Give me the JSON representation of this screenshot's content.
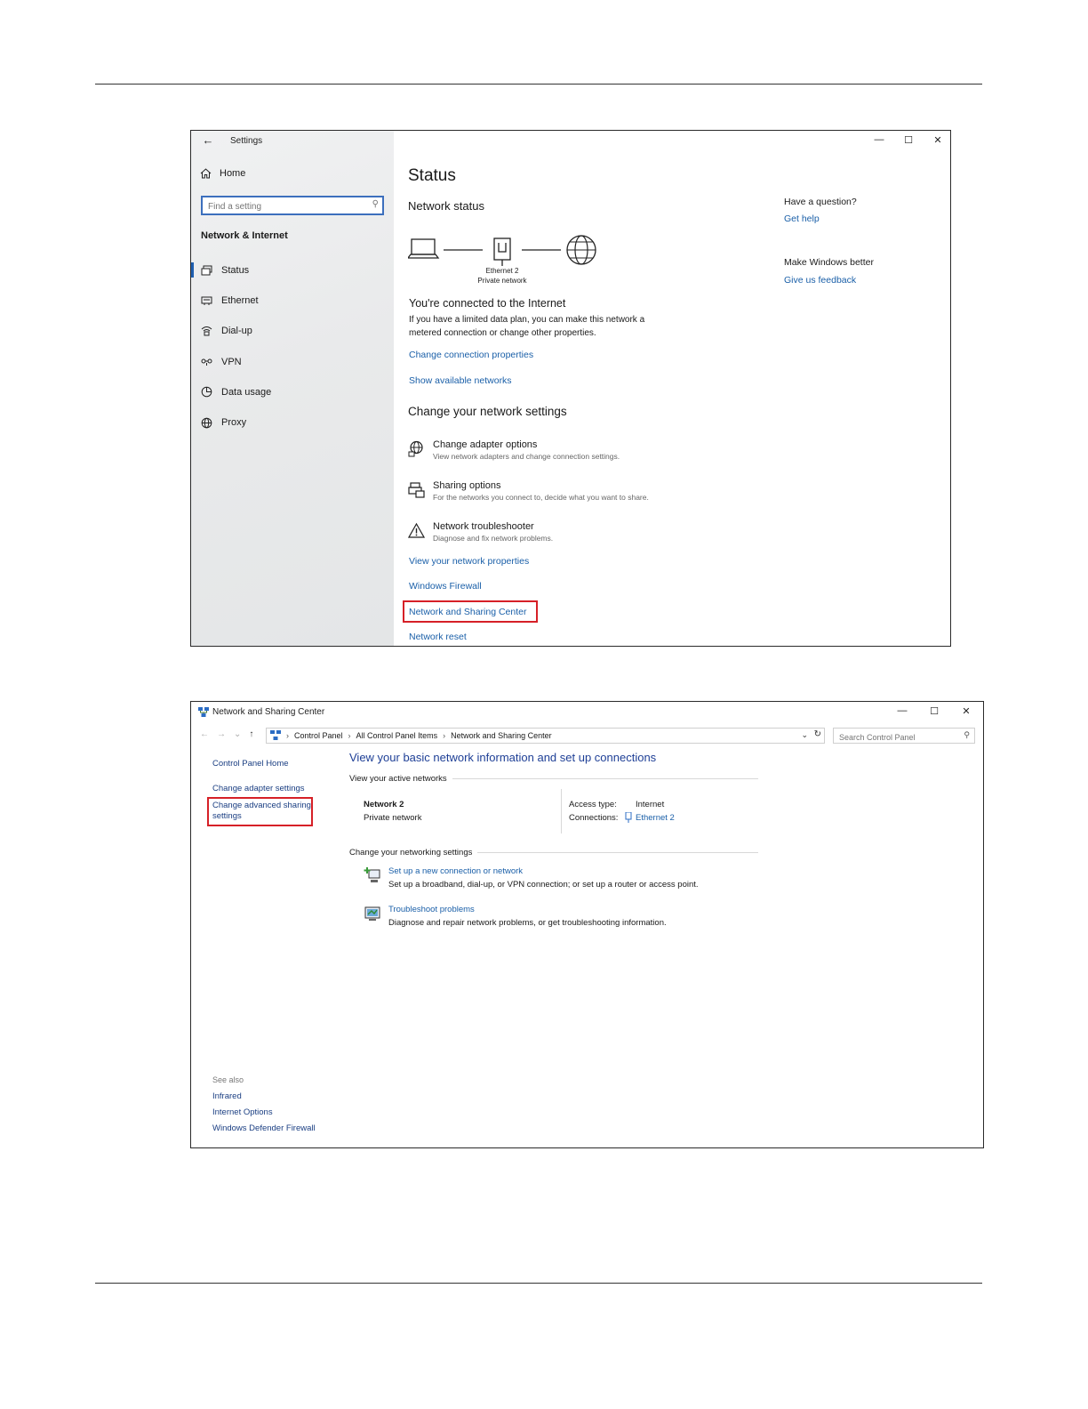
{
  "settings": {
    "window_title": "Settings",
    "home": "Home",
    "search_placeholder": "Find a setting",
    "section": "Network & Internet",
    "nav": [
      {
        "label": "Status",
        "icon": "status-icon"
      },
      {
        "label": "Ethernet",
        "icon": "ethernet-icon"
      },
      {
        "label": "Dial-up",
        "icon": "dialup-icon"
      },
      {
        "label": "VPN",
        "icon": "vpn-icon"
      },
      {
        "label": "Data usage",
        "icon": "data-usage-icon"
      },
      {
        "label": "Proxy",
        "icon": "proxy-icon"
      }
    ],
    "selected_nav": "Status",
    "controls": {
      "minimize": "—",
      "maximize": "☐",
      "close": "✕"
    },
    "page_title": "Status",
    "network_status": "Network status",
    "adapter_name": "Ethernet 2",
    "adapter_network": "Private network",
    "connected_title": "You're connected to the Internet",
    "connected_desc": "If you have a limited data plan, you can make this network a metered connection or change other properties.",
    "link_change_props": "Change connection properties",
    "link_show_networks": "Show available networks",
    "change_title": "Change your network settings",
    "options": [
      {
        "title": "Change adapter options",
        "desc": "View network adapters and change connection settings.",
        "icon": "adapter-icon"
      },
      {
        "title": "Sharing options",
        "desc": "For the networks you connect to, decide what you want to share.",
        "icon": "sharing-icon"
      },
      {
        "title": "Network troubleshooter",
        "desc": "Diagnose and fix network problems.",
        "icon": "warning-icon"
      }
    ],
    "link_view_props": "View your network properties",
    "link_firewall": "Windows Firewall",
    "link_nsc": "Network and Sharing Center",
    "link_reset": "Network reset",
    "aside": {
      "question": "Have a question?",
      "get_help": "Get help",
      "better": "Make Windows better",
      "feedback": "Give us feedback"
    },
    "highlight_color": "#d62027",
    "link_color": "#1a5fa8"
  },
  "nsc": {
    "window_title": "Network and Sharing Center",
    "controls": {
      "minimize": "—",
      "maximize": "☐",
      "close": "✕"
    },
    "nav_back": "←",
    "nav_forward": "→",
    "nav_recent": "⌄",
    "nav_up": "↑",
    "breadcrumb": [
      "Control Panel",
      "All Control Panel Items",
      "Network and Sharing Center"
    ],
    "breadcrumb_sep": "›",
    "search_placeholder": "Search Control Panel",
    "left_links": {
      "home": "Control Panel Home",
      "adapter": "Change adapter settings",
      "advanced_line1": "Change advanced sharing",
      "advanced_line2": "settings"
    },
    "see_also": "See also",
    "see_also_links": [
      "Infrared",
      "Internet Options",
      "Windows Defender Firewall"
    ],
    "main_title": "View your basic network information and set up connections",
    "active_networks": "View your active networks",
    "network_name": "Network 2",
    "network_type": "Private network",
    "access_type_label": "Access type:",
    "access_type_value": "Internet",
    "connections_label": "Connections:",
    "connections_value": "Ethernet 2",
    "change_settings": "Change your networking settings",
    "tasks": [
      {
        "link": "Set up a new connection or network",
        "desc": "Set up a broadband, dial-up, or VPN connection; or set up a router or access point.",
        "icon": "new-connection-icon"
      },
      {
        "link": "Troubleshoot problems",
        "desc": "Diagnose and repair network problems, or get troubleshooting information.",
        "icon": "troubleshoot-icon"
      }
    ]
  }
}
